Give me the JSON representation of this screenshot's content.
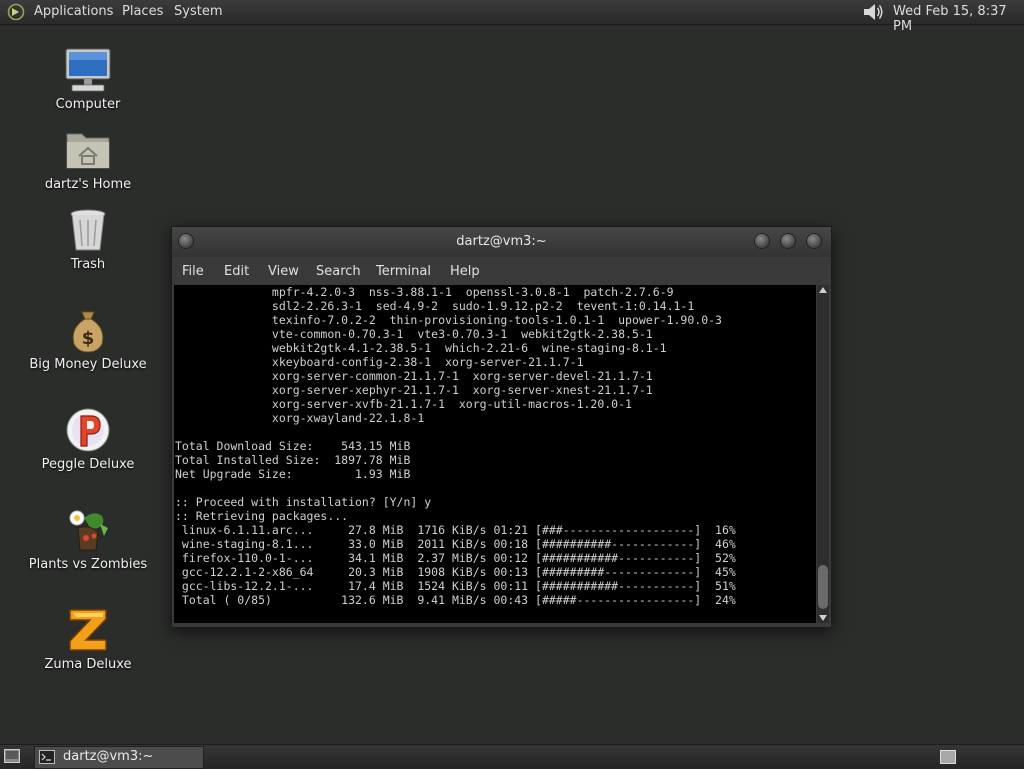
{
  "top_panel": {
    "menus": [
      "Applications",
      "Places",
      "System"
    ],
    "clock": "Wed Feb 15,  8:37 PM"
  },
  "desktop_icons": [
    {
      "label": "Computer",
      "icon": "computer-icon"
    },
    {
      "label": "dartz's Home",
      "icon": "home-folder-icon"
    },
    {
      "label": "Trash",
      "icon": "trash-icon"
    },
    {
      "label": "Big Money Deluxe",
      "icon": "money-bag-icon"
    },
    {
      "label": "Peggle Deluxe",
      "icon": "peggle-icon"
    },
    {
      "label": "Plants vs Zombies",
      "icon": "plants-vs-zombies-icon"
    },
    {
      "label": "Zuma Deluxe",
      "icon": "zuma-icon"
    }
  ],
  "terminal": {
    "title": "dartz@vm3:~",
    "menu": [
      "File",
      "Edit",
      "View",
      "Search",
      "Terminal",
      "Help"
    ],
    "lines": [
      "              mpfr-4.2.0-3  nss-3.88.1-1  openssl-3.0.8-1  patch-2.7.6-9",
      "              sdl2-2.26.3-1  sed-4.9-2  sudo-1.9.12.p2-2  tevent-1:0.14.1-1",
      "              texinfo-7.0.2-2  thin-provisioning-tools-1.0.1-1  upower-1.90.0-3",
      "              vte-common-0.70.3-1  vte3-0.70.3-1  webkit2gtk-2.38.5-1",
      "              webkit2gtk-4.1-2.38.5-1  which-2.21-6  wine-staging-8.1-1",
      "              xkeyboard-config-2.38-1  xorg-server-21.1.7-1",
      "              xorg-server-common-21.1.7-1  xorg-server-devel-21.1.7-1",
      "              xorg-server-xephyr-21.1.7-1  xorg-server-xnest-21.1.7-1",
      "              xorg-server-xvfb-21.1.7-1  xorg-util-macros-1.20.0-1",
      "              xorg-xwayland-22.1.8-1",
      "",
      "Total Download Size:    543.15 MiB",
      "Total Installed Size:  1897.78 MiB",
      "Net Upgrade Size:         1.93 MiB",
      "",
      ":: Proceed with installation? [Y/n] y",
      ":: Retrieving packages...",
      " linux-6.1.11.arc...     27.8 MiB  1716 KiB/s 01:21 [###-------------------]  16%",
      " wine-staging-8.1...     33.0 MiB  2011 KiB/s 00:18 [##########------------]  46%",
      " firefox-110.0-1-...     34.1 MiB  2.37 MiB/s 00:12 [###########-----------]  52%",
      " gcc-12.2.1-2-x86_64     20.3 MiB  1908 KiB/s 00:13 [#########-------------]  45%",
      " gcc-libs-12.2.1-...     17.4 MiB  1524 KiB/s 00:11 [###########-----------]  51%",
      " Total ( 0/85)          132.6 MiB  9.41 MiB/s 00:43 [#####-----------------]  24%"
    ]
  },
  "taskbar": {
    "task_label": "dartz@vm3:~"
  }
}
